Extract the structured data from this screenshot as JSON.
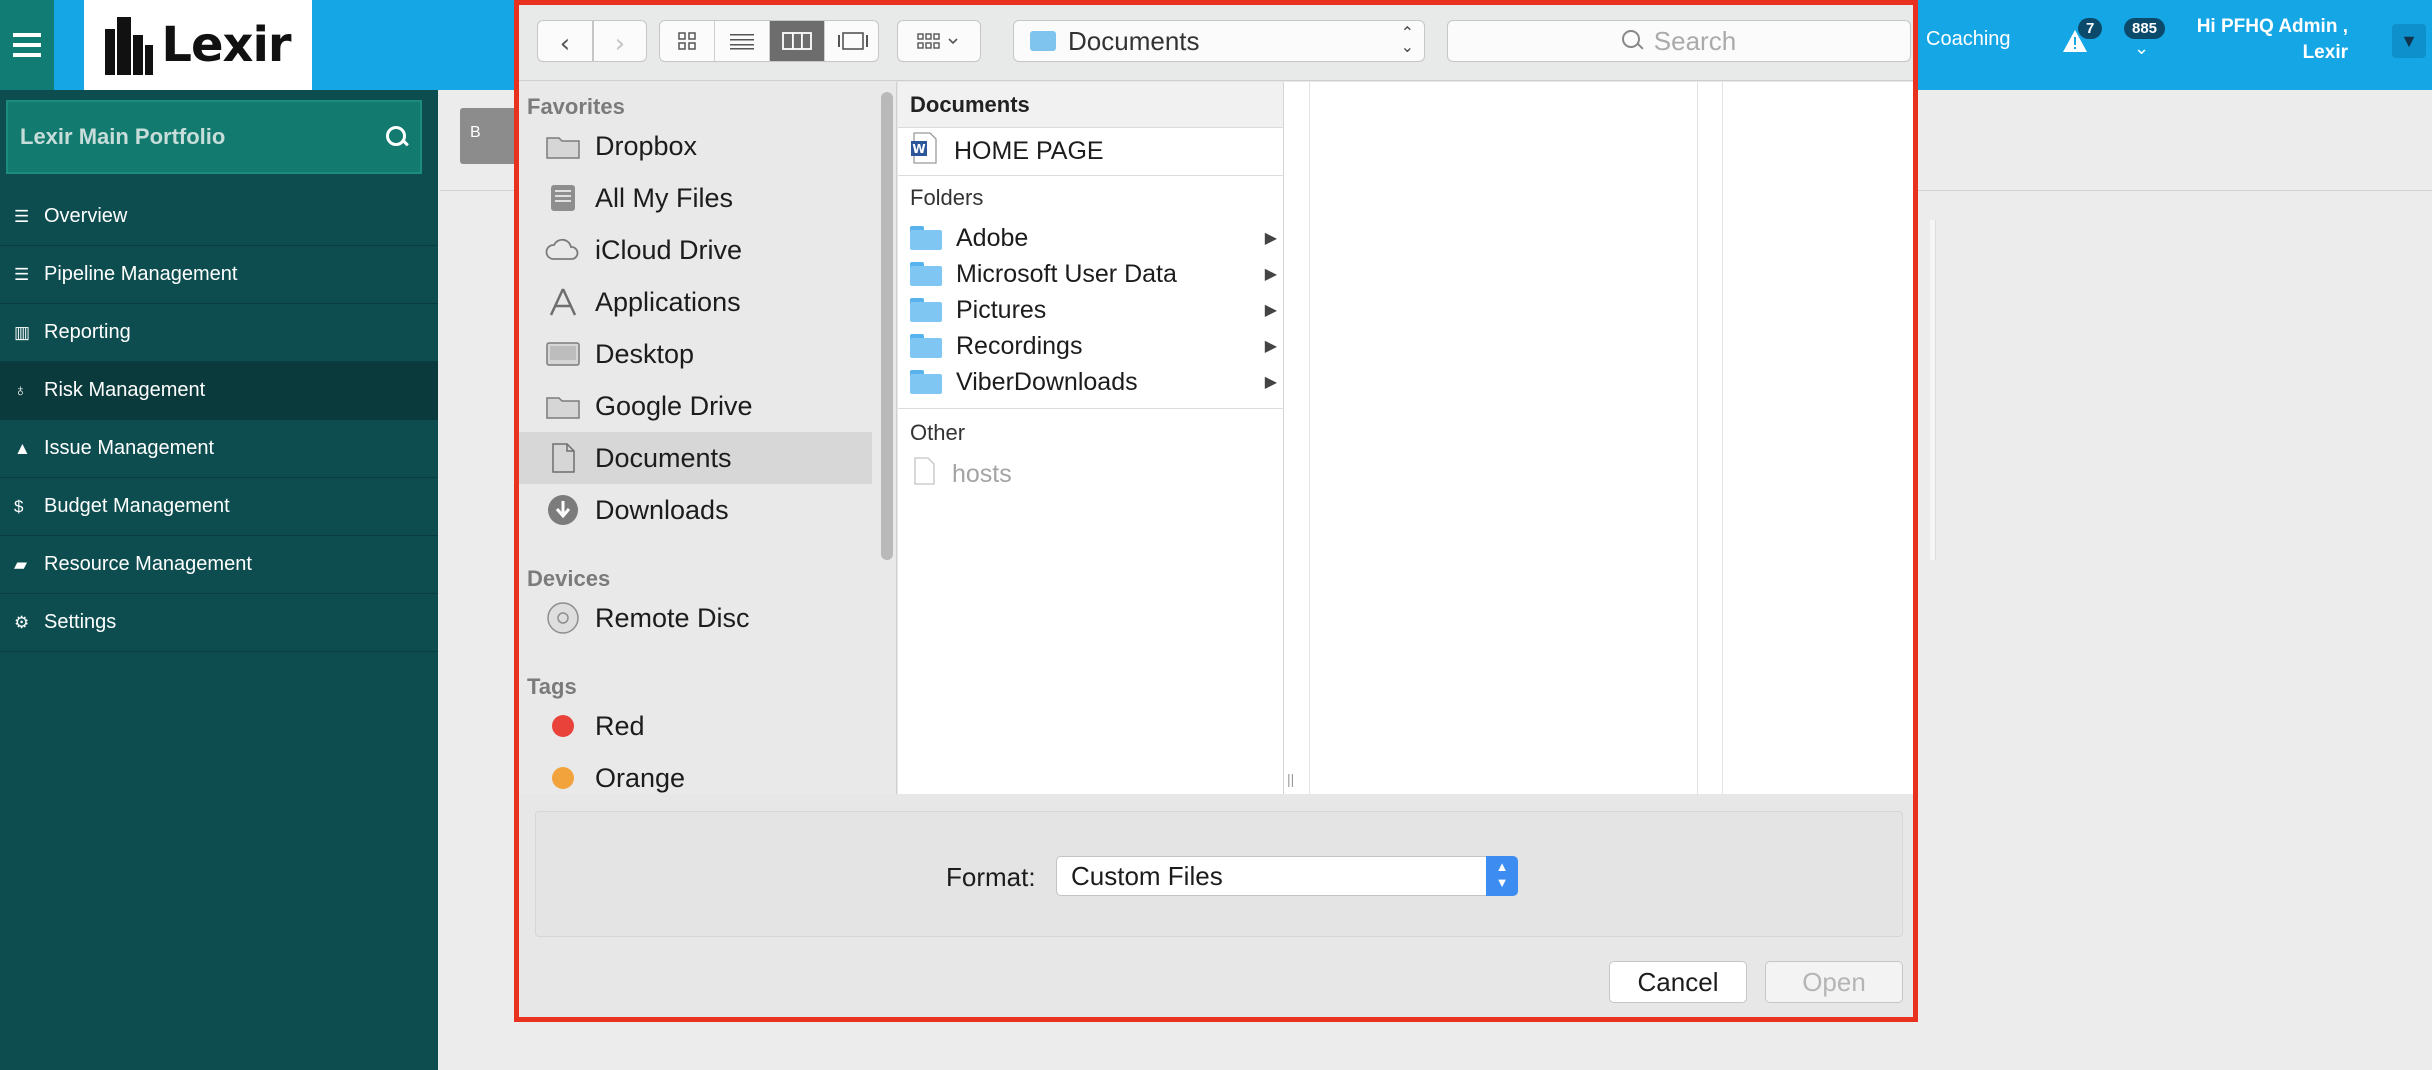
{
  "app": {
    "logo_text": "Lexir",
    "top_nav": {
      "coaching": "Coaching",
      "alerts_count": "7",
      "notifications_count": "885",
      "greeting": "Hi PFHQ Admin ,",
      "org": "Lexir"
    }
  },
  "sidebar": {
    "portfolio": "Lexir Main Portfolio",
    "items": [
      {
        "label": "Overview",
        "icon": "list-icon"
      },
      {
        "label": "Pipeline Management",
        "icon": "list-icon"
      },
      {
        "label": "Reporting",
        "icon": "bar-chart-icon"
      },
      {
        "label": "Risk Management",
        "icon": "lightbulb-icon"
      },
      {
        "label": "Issue Management",
        "icon": "warning-icon"
      },
      {
        "label": "Budget Management",
        "icon": "dollar-icon"
      },
      {
        "label": "Resource Management",
        "icon": "folder-open-icon"
      },
      {
        "label": "Settings",
        "icon": "gears-icon"
      }
    ],
    "active_index": 3
  },
  "content": {
    "back_button": "B"
  },
  "dialog": {
    "path": "Documents",
    "search_placeholder": "Search",
    "sidebar": {
      "favorites_header": "Favorites",
      "favorites": [
        "Dropbox",
        "All My Files",
        "iCloud Drive",
        "Applications",
        "Desktop",
        "Google Drive",
        "Documents",
        "Downloads"
      ],
      "devices_header": "Devices",
      "devices": [
        "Remote Disc"
      ],
      "tags_header": "Tags",
      "tags": [
        {
          "label": "Red",
          "color": "#e8423a"
        },
        {
          "label": "Orange",
          "color": "#f3a33c"
        }
      ]
    },
    "column": {
      "header": "Documents",
      "document": "HOME PAGE",
      "folders_header": "Folders",
      "folders": [
        "Adobe",
        "Microsoft User Data",
        "Pictures",
        "Recordings",
        "ViberDownloads"
      ],
      "other_header": "Other",
      "other": [
        "hosts"
      ]
    },
    "format_label": "Format:",
    "format_value": "Custom Files",
    "cancel": "Cancel",
    "open": "Open"
  }
}
